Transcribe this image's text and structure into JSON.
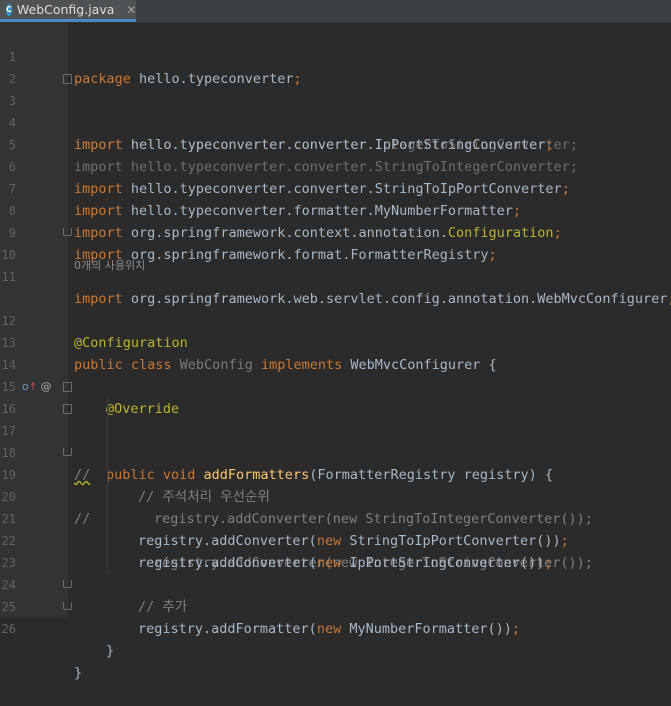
{
  "tab": {
    "icon_letter": "C",
    "label": "WebConfig.java",
    "close": "✕"
  },
  "usage_hint": "0개의 사용위치",
  "lines": {
    "l1": {
      "num": "1",
      "kw": "package",
      "rest": " hello.typeconverter",
      "sc": ";"
    },
    "l2": {
      "num": "2"
    },
    "l3": {
      "num": "3",
      "kw": "import",
      "rest": " hello.typeconverter.converter.IntegerToStringConverter",
      "sc": ";"
    },
    "l4": {
      "num": "4",
      "kw": "import",
      "rest": " hello.typeconverter.converter.IpPortStringConverter",
      "sc": ";"
    },
    "l5": {
      "num": "5",
      "kw": "import",
      "rest": " hello.typeconverter.converter.StringToIntegerConverter",
      "sc": ";"
    },
    "l6": {
      "num": "6",
      "kw": "import",
      "rest": " hello.typeconverter.converter.StringToIpPortConverter",
      "sc": ";"
    },
    "l7": {
      "num": "7",
      "kw": "import",
      "rest": " hello.typeconverter.formatter.MyNumberFormatter",
      "sc": ";"
    },
    "l8": {
      "num": "8",
      "kw": "import",
      "rest": " org.springframework.context.annotation.",
      "an": "Configuration",
      "sc": ";"
    },
    "l9": {
      "num": "9",
      "kw": "import",
      "rest": " org.springframework.format.FormatterRegistry",
      "sc": ";"
    },
    "l10": {
      "num": "10",
      "kw": "import",
      "rest": " org.springframework.web.servlet.config.annotation.WebMvcConfigurer",
      "sc": ";"
    },
    "l11": {
      "num": "11"
    },
    "l12": {
      "num": "12",
      "an": "@Configuration"
    },
    "l13": {
      "num": "13",
      "kw1": "public class",
      "name": " WebConfig ",
      "kw2": "implements",
      "rest": " WebMvcConfigurer {"
    },
    "l14": {
      "num": "14"
    },
    "l15": {
      "num": "15",
      "an": "@Override"
    },
    "l16": {
      "num": "16",
      "kw": "public void",
      "fn": " addFormatters",
      "rest": "(FormatterRegistry registry) {",
      "marker": "@"
    },
    "l17": {
      "num": "17",
      "cm": "// 주석처리 우선순위"
    },
    "l18": {
      "num": "18",
      "mark": "//",
      "rest": "registry.addConverter(new StringToIntegerConverter());"
    },
    "l19": {
      "num": "19",
      "mark": "//",
      "rest": "registry.addConverter(new IntegerToStringConverter());"
    },
    "l20": {
      "num": "20",
      "pre": "registry.addConverter(",
      "kw": "new",
      "rest": " StringToIpPortConverter())",
      "sc": ";"
    },
    "l21": {
      "num": "21",
      "pre": "registry.addConverter(",
      "kw": "new",
      "rest": " IpPortStringConverter())",
      "sc": ";"
    },
    "l22": {
      "num": "22"
    },
    "l23": {
      "num": "23",
      "cm": "// 추가"
    },
    "l24": {
      "num": "24",
      "pre": "registry.addFormatter(",
      "kw": "new",
      "rest": " MyNumberFormatter())",
      "sc": ";"
    },
    "l25": {
      "num": "25",
      "rest": "}"
    },
    "l26": {
      "num": "26",
      "rest": "}"
    }
  },
  "colors": {
    "background": "#2b2b2b",
    "keyword": "#cc7832",
    "annotation": "#bbb529",
    "method": "#ffc66d",
    "comment": "#808080",
    "text": "#a9b7c6"
  }
}
